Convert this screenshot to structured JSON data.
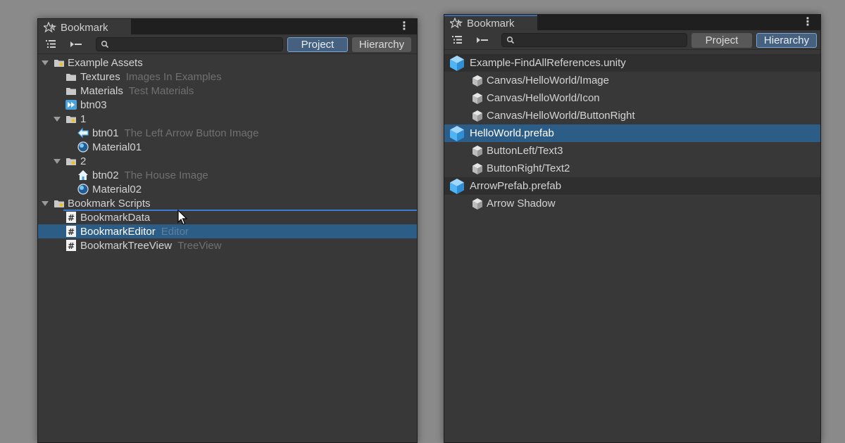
{
  "colors": {
    "background": "#8a8a8a",
    "panel": "#383838",
    "selection": "#2c5d87",
    "accent_button": "#46607f",
    "drop_indicator": "#3a7bd5"
  },
  "left_window": {
    "tab_title": "Bookmark",
    "tab_icon": "bookmark-star-icon",
    "menu_icon": "⋮",
    "toolbar": {
      "list_icon_glyph": "☷",
      "collapse_icon_glyph": "▸━",
      "search_placeholder": "",
      "project_label": "Project",
      "hierarchy_label": "Hierarchy",
      "active": "Project"
    },
    "tree": [
      {
        "label": "Example Assets",
        "note": "",
        "icon": "folder-bookmark-icon",
        "expanded": true
      },
      {
        "label": "Textures",
        "note": "Images In Examples",
        "icon": "folder-icon"
      },
      {
        "label": "Materials",
        "note": "Test Materials",
        "icon": "folder-icon"
      },
      {
        "label": "btn03",
        "note": "",
        "icon": "fast-forward-icon"
      },
      {
        "label": "1",
        "note": "",
        "icon": "folder-bookmark-icon",
        "expanded": true
      },
      {
        "label": "btn01",
        "note": "The Left Arrow Button Image",
        "icon": "left-arrow-icon"
      },
      {
        "label": "Material01",
        "note": "",
        "icon": "material-sphere-icon"
      },
      {
        "label": "2",
        "note": "",
        "icon": "folder-bookmark-icon",
        "expanded": true
      },
      {
        "label": "btn02",
        "note": "The House Image",
        "icon": "house-icon"
      },
      {
        "label": "Material02",
        "note": "",
        "icon": "material-sphere-icon"
      },
      {
        "label": "Bookmark Scripts",
        "note": "",
        "icon": "folder-bookmark-icon",
        "expanded": true
      },
      {
        "label": "BookmarkData",
        "note": "",
        "icon": "csharp-script-icon"
      },
      {
        "label": "BookmarkEditor",
        "note": "Editor",
        "icon": "csharp-script-icon",
        "selected": true
      },
      {
        "label": "BookmarkTreeView",
        "note": "TreeView",
        "icon": "csharp-script-icon"
      }
    ]
  },
  "right_window": {
    "tab_title": "Bookmark",
    "tab_icon": "bookmark-star-icon",
    "menu_icon": "⋮",
    "toolbar": {
      "list_icon_glyph": "☷",
      "collapse_icon_glyph": "▸━",
      "search_placeholder": "",
      "project_label": "Project",
      "hierarchy_label": "Hierarchy",
      "active": "Hierarchy"
    },
    "tree": [
      {
        "label": "Example-FindAllReferences.unity",
        "icon": "unity-scene-cube-icon",
        "header": true
      },
      {
        "label": "Canvas/HelloWorld/Image",
        "icon": "gameobject-cube-icon"
      },
      {
        "label": "Canvas/HelloWorld/Icon",
        "icon": "gameobject-cube-icon"
      },
      {
        "label": "Canvas/HelloWorld/ButtonRight",
        "icon": "gameobject-cube-icon"
      },
      {
        "label": "HelloWorld.prefab",
        "icon": "prefab-cube-icon",
        "header": true,
        "selected": true
      },
      {
        "label": "ButtonLeft/Text3",
        "icon": "gameobject-cube-icon"
      },
      {
        "label": "ButtonRight/Text2",
        "icon": "gameobject-cube-icon"
      },
      {
        "label": "ArrowPrefab.prefab",
        "icon": "prefab-cube-icon",
        "header": true
      },
      {
        "label": "Arrow Shadow",
        "icon": "gameobject-cube-icon"
      }
    ]
  }
}
